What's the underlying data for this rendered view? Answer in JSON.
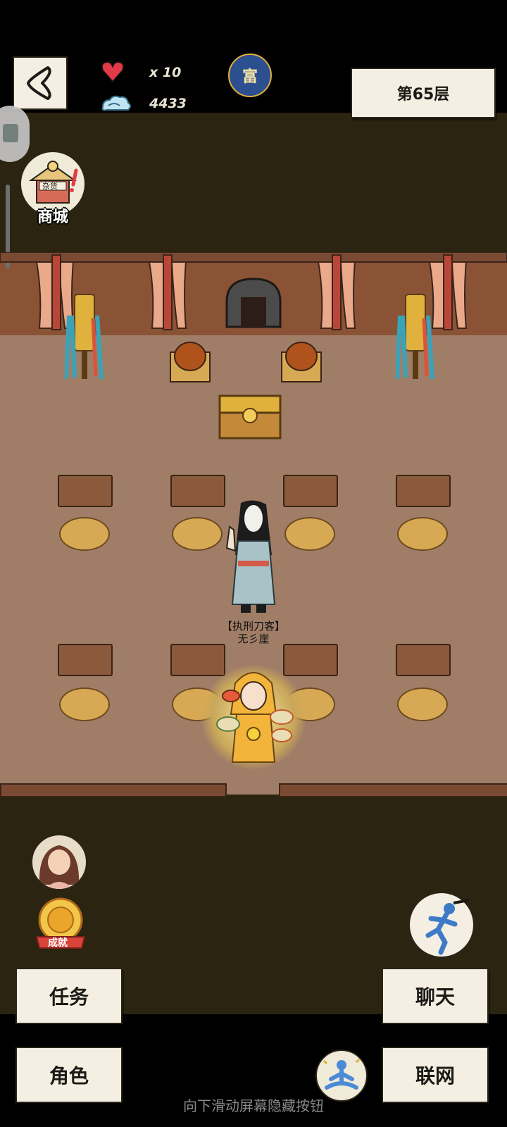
{
  "header": {
    "lives": "x 10",
    "currency": "4433",
    "zodiac_glyph": "富",
    "floor_label": "第65层"
  },
  "shop": {
    "label": "商城",
    "sign": "杂货"
  },
  "npc": {
    "title": "【执刑刀客】",
    "name": "无彡崖"
  },
  "badge": {
    "label": "成就"
  },
  "menu": {
    "task": "任务",
    "character": "角色",
    "chat": "聊天",
    "network": "联网"
  },
  "hint": "向下滑动屏幕隐藏按钮",
  "colors": {
    "floor": "#a07d66",
    "wall": "#8a5335",
    "dark_area": "#2a2410",
    "paper": "#f4efe2",
    "accent_gold": "#e0b13c"
  }
}
